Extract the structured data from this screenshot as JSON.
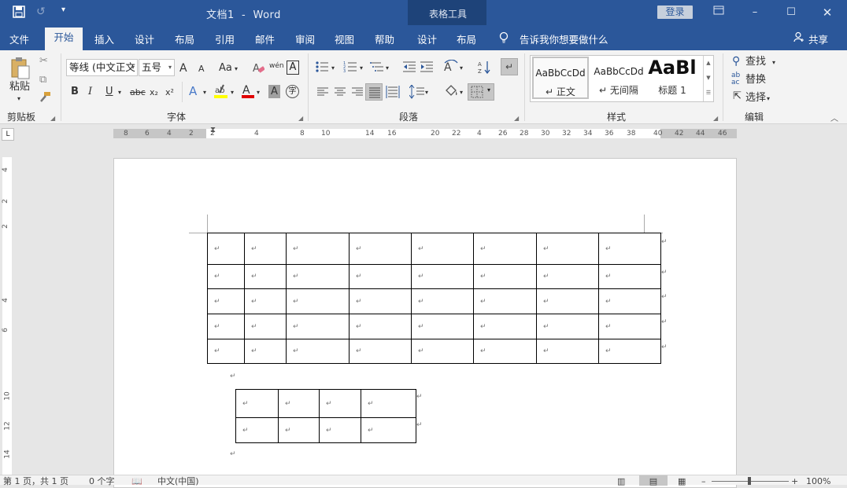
{
  "titlebar": {
    "doc_name": "文档1",
    "separator": "-",
    "app_name": "Word",
    "table_tools": "表格工具",
    "login": "登录"
  },
  "tabs": [
    "文件",
    "开始",
    "插入",
    "设计",
    "布局",
    "引用",
    "邮件",
    "审阅",
    "视图",
    "帮助",
    "设计",
    "布局"
  ],
  "tell_me": "告诉我你想要做什么",
  "share": "共享",
  "ribbon": {
    "clipboard": {
      "paste": "粘贴",
      "label": "剪贴板"
    },
    "font": {
      "name": "等线 (中文正文",
      "size": "五号",
      "label": "字体",
      "aa": "Aa",
      "wen": "wén",
      "bold": "B",
      "italic": "I",
      "underline": "U",
      "strike": "abc",
      "sub": "x₂",
      "sup": "x²",
      "grow": "A",
      "shrink": "A",
      "clear": "A",
      "box": "A",
      "fontcolor": "A",
      "charshade": "A",
      "circle": "字"
    },
    "paragraph": {
      "label": "段落"
    },
    "styles": {
      "label": "样式",
      "items": [
        {
          "sample": "AaBbCcDd",
          "name": "正文"
        },
        {
          "sample": "AaBbCcDd",
          "name": "无间隔"
        },
        {
          "sample": "AaBl",
          "name": "标题 1"
        }
      ]
    },
    "editing": {
      "find": "查找",
      "replace": "替换",
      "select": "选择",
      "label": "编辑"
    }
  },
  "ruler": {
    "h_numbers": [
      "8",
      "6",
      "4",
      "2",
      "2",
      "4",
      "8",
      "10",
      "14",
      "16",
      "20",
      "22",
      "4",
      "26",
      "28",
      "30",
      "32",
      "34",
      "36",
      "38",
      "40",
      "42",
      "44",
      "46"
    ],
    "v_numbers": [
      "4",
      "2",
      "2",
      "4",
      "6",
      "10",
      "12",
      "14"
    ]
  },
  "document": {
    "para_mark": "↵",
    "table1": {
      "rows": 5,
      "cols": 8
    },
    "table2": {
      "rows": 2,
      "cols": 4
    }
  },
  "statusbar": {
    "page": "第 1 页，共 1 页",
    "words": "0 个字",
    "lang": "中文(中国)",
    "zoom": "100%"
  },
  "colors": {
    "accent": "#2b579a",
    "table_tools_bg": "#1e4379",
    "font_color_bar": "#e00000",
    "highlight_bar": "#ffff00"
  }
}
